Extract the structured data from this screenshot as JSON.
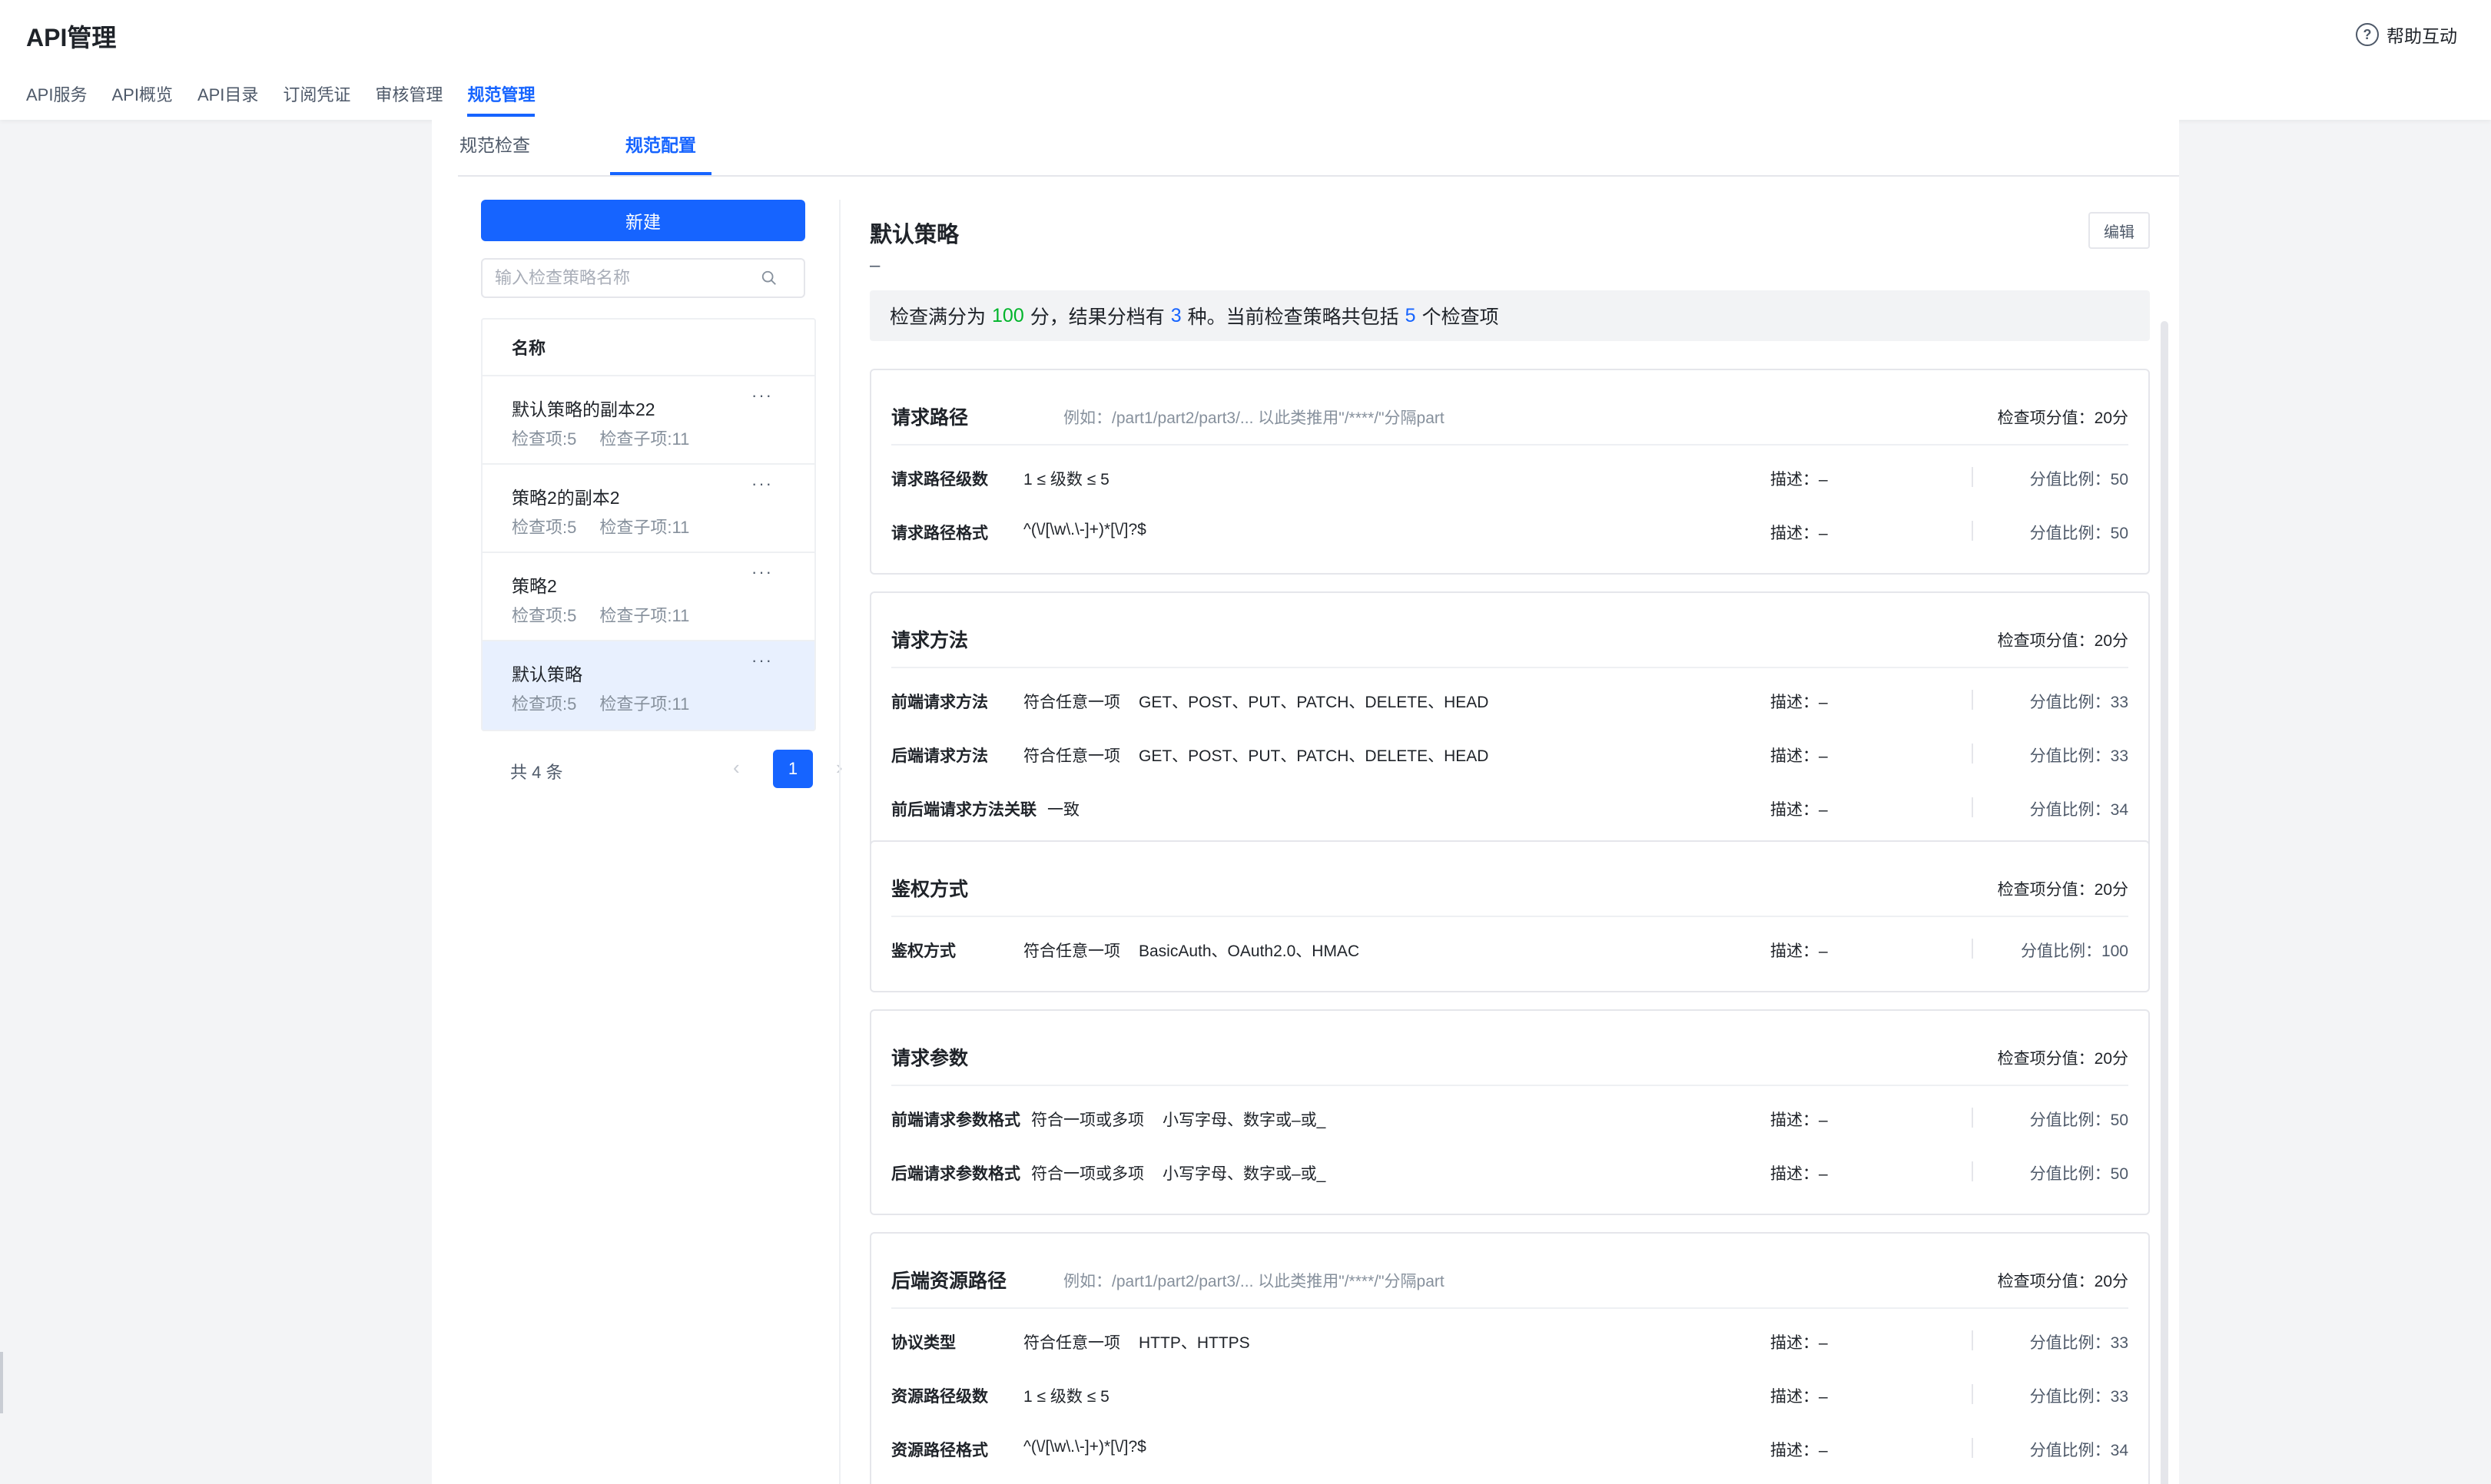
{
  "app": {
    "title": "API管理",
    "help_label": "帮助互动"
  },
  "topnav": [
    {
      "label": "API服务",
      "active": false
    },
    {
      "label": "API概览",
      "active": false
    },
    {
      "label": "API目录",
      "active": false
    },
    {
      "label": "订阅凭证",
      "active": false
    },
    {
      "label": "审核管理",
      "active": false
    },
    {
      "label": "规范管理",
      "active": true
    }
  ],
  "subtabs": [
    {
      "label": "规范检查",
      "active": false
    },
    {
      "label": "规范配置",
      "active": true
    }
  ],
  "sidebar": {
    "new_label": "新建",
    "search_placeholder": "输入检查策略名称",
    "list_header": "名称",
    "items": [
      {
        "name": "默认策略的副本22",
        "items_label": "检查项:5",
        "subitems_label": "检查子项:11",
        "more": "···",
        "selected": false
      },
      {
        "name": "策略2的副本2",
        "items_label": "检查项:5",
        "subitems_label": "检查子项:11",
        "more": "···",
        "selected": false
      },
      {
        "name": "策略2",
        "items_label": "检查项:5",
        "subitems_label": "检查子项:11",
        "more": "···",
        "selected": false
      },
      {
        "name": "默认策略",
        "items_label": "检查项:5",
        "subitems_label": "检查子项:11",
        "more": "···",
        "selected": true
      }
    ],
    "pager": {
      "total": "共 4 条",
      "prev": "‹",
      "page": "1",
      "next": "›"
    }
  },
  "policy": {
    "title": "默认策略",
    "edit_label": "编辑",
    "description": "–",
    "summary": {
      "p1": "检查满分为",
      "full_score": "100",
      "p2": "分，结果分档有",
      "levels": "3",
      "p3": "种。当前检查策略共包括",
      "count": "5",
      "p4": "个检查项"
    },
    "cards": [
      {
        "title": "请求路径",
        "hint": "例如：/part1/part2/part3/... 以此类推用\"/****/\"分隔part",
        "score": "检查项分值：20分",
        "rows": [
          {
            "name": "请求路径级数",
            "mode": "",
            "rule": "1 ≤ 级数 ≤ 5",
            "desc": "描述：–",
            "ratio_label": "分值比例：",
            "ratio": "50"
          },
          {
            "name": "请求路径格式",
            "mode": "",
            "rule": "^(\\/[\\w\\.\\-]+)*[\\/]?$",
            "desc": "描述：–",
            "ratio_label": "分值比例：",
            "ratio": "50"
          }
        ]
      },
      {
        "title": "请求方法",
        "hint": "",
        "score": "检查项分值：20分",
        "rows": [
          {
            "name": "前端请求方法",
            "mode": "符合任意一项",
            "rule": "GET、POST、PUT、PATCH、DELETE、HEAD",
            "desc": "描述：–",
            "ratio_label": "分值比例：",
            "ratio": "33"
          },
          {
            "name": "后端请求方法",
            "mode": "符合任意一项",
            "rule": "GET、POST、PUT、PATCH、DELETE、HEAD",
            "desc": "描述：–",
            "ratio_label": "分值比例：",
            "ratio": "33"
          },
          {
            "name": "前后端请求方法关联",
            "mode": "",
            "rule": "一致",
            "desc": "描述：–",
            "ratio_label": "分值比例：",
            "ratio": "34"
          }
        ]
      },
      {
        "title": "鉴权方式",
        "hint": "",
        "score": "检查项分值：20分",
        "rows": [
          {
            "name": "鉴权方式",
            "mode": "符合任意一项",
            "rule": "BasicAuth、OAuth2.0、HMAC",
            "desc": "描述：–",
            "ratio_label": "分值比例：",
            "ratio": "100"
          }
        ]
      },
      {
        "title": "请求参数",
        "hint": "",
        "score": "检查项分值：20分",
        "rows": [
          {
            "name": "前端请求参数格式",
            "mode": "符合一项或多项",
            "rule": "小写字母、数字或–或_",
            "desc": "描述：–",
            "ratio_label": "分值比例：",
            "ratio": "50"
          },
          {
            "name": "后端请求参数格式",
            "mode": "符合一项或多项",
            "rule": "小写字母、数字或–或_",
            "desc": "描述：–",
            "ratio_label": "分值比例：",
            "ratio": "50"
          }
        ]
      },
      {
        "title": "后端资源路径",
        "hint": "例如：/part1/part2/part3/... 以此类推用\"/****/\"分隔part",
        "score": "检查项分值：20分",
        "rows": [
          {
            "name": "协议类型",
            "mode": "符合任意一项",
            "rule": "HTTP、HTTPS",
            "desc": "描述：–",
            "ratio_label": "分值比例：",
            "ratio": "33"
          },
          {
            "name": "资源路径级数",
            "mode": "",
            "rule": "1 ≤ 级数 ≤ 5",
            "desc": "描述：–",
            "ratio_label": "分值比例：",
            "ratio": "33"
          },
          {
            "name": "资源路径格式",
            "mode": "",
            "rule": "^(\\/[\\w\\.\\-]+)*[\\/]?$",
            "desc": "描述：–",
            "ratio_label": "分值比例：",
            "ratio": "34"
          }
        ]
      }
    ]
  }
}
